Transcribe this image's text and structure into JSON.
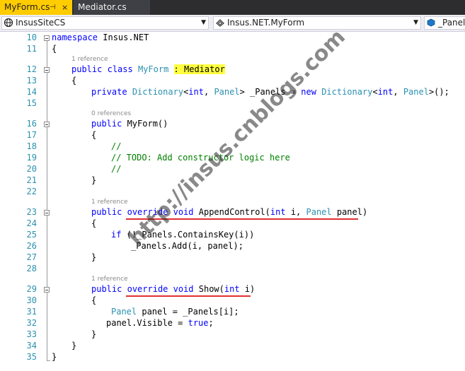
{
  "tabs": [
    {
      "label": "MyForm.cs",
      "pin": "⊣",
      "close": "×"
    },
    {
      "label": "Mediator.cs"
    }
  ],
  "nav": {
    "project": "InsusSiteCS",
    "class": "Insus.NET.MyForm",
    "member": "_Panels"
  },
  "line_numbers": [
    "10",
    "11",
    "12",
    "13",
    "14",
    "15",
    "16",
    "17",
    "18",
    "19",
    "20",
    "21",
    "22",
    "23",
    "24",
    "25",
    "26",
    "27",
    "28",
    "29",
    "30",
    "31",
    "32",
    "33",
    "34",
    "35"
  ],
  "refs": {
    "myform_class": "1 reference",
    "constructor": "0 references",
    "append_control": "1 reference",
    "show": "1 reference"
  },
  "code": {
    "l10": [
      "namespace",
      " Insus.NET"
    ],
    "l11": "{",
    "l12": [
      "public",
      " ",
      "class",
      " ",
      "MyForm",
      " ",
      ": Mediator"
    ],
    "l13": "{",
    "l14": [
      "private",
      " ",
      "Dictionary",
      "<",
      "int",
      ", ",
      "Panel",
      "> _Panels = ",
      "new",
      " ",
      "Dictionary",
      "<",
      "int",
      ", ",
      "Panel",
      ">();"
    ],
    "l16": [
      "public",
      " MyForm()"
    ],
    "l17": "{",
    "l18": "//",
    "l19": "// TODO: Add constructor logic here",
    "l20": "//",
    "l21": "}",
    "l23": [
      "public",
      " ",
      "override",
      " ",
      "void",
      " AppendControl(",
      "int",
      " i, ",
      "Panel",
      " panel)"
    ],
    "l24": "{",
    "l25": [
      "if",
      " (!_Panels.ContainsKey(i))"
    ],
    "l26": "_Panels.Add(i, panel);",
    "l27": "}",
    "l29": [
      "public",
      " ",
      "override",
      " ",
      "void",
      " Show(",
      "int",
      " i)"
    ],
    "l30": "{",
    "l31": [
      "Panel",
      " panel = _Panels[i];"
    ],
    "l32": [
      "panel.Visible = ",
      "true",
      ";"
    ],
    "l33": "}",
    "l34": "}",
    "l35": "}"
  },
  "watermark": "http://insus.cnblogs.com",
  "colors": {
    "keyword": "#0000ff",
    "type": "#2b91af",
    "comment": "#008000",
    "highlight": "#ffff40",
    "underline": "#e03030",
    "active_tab": "#ffcc00"
  }
}
